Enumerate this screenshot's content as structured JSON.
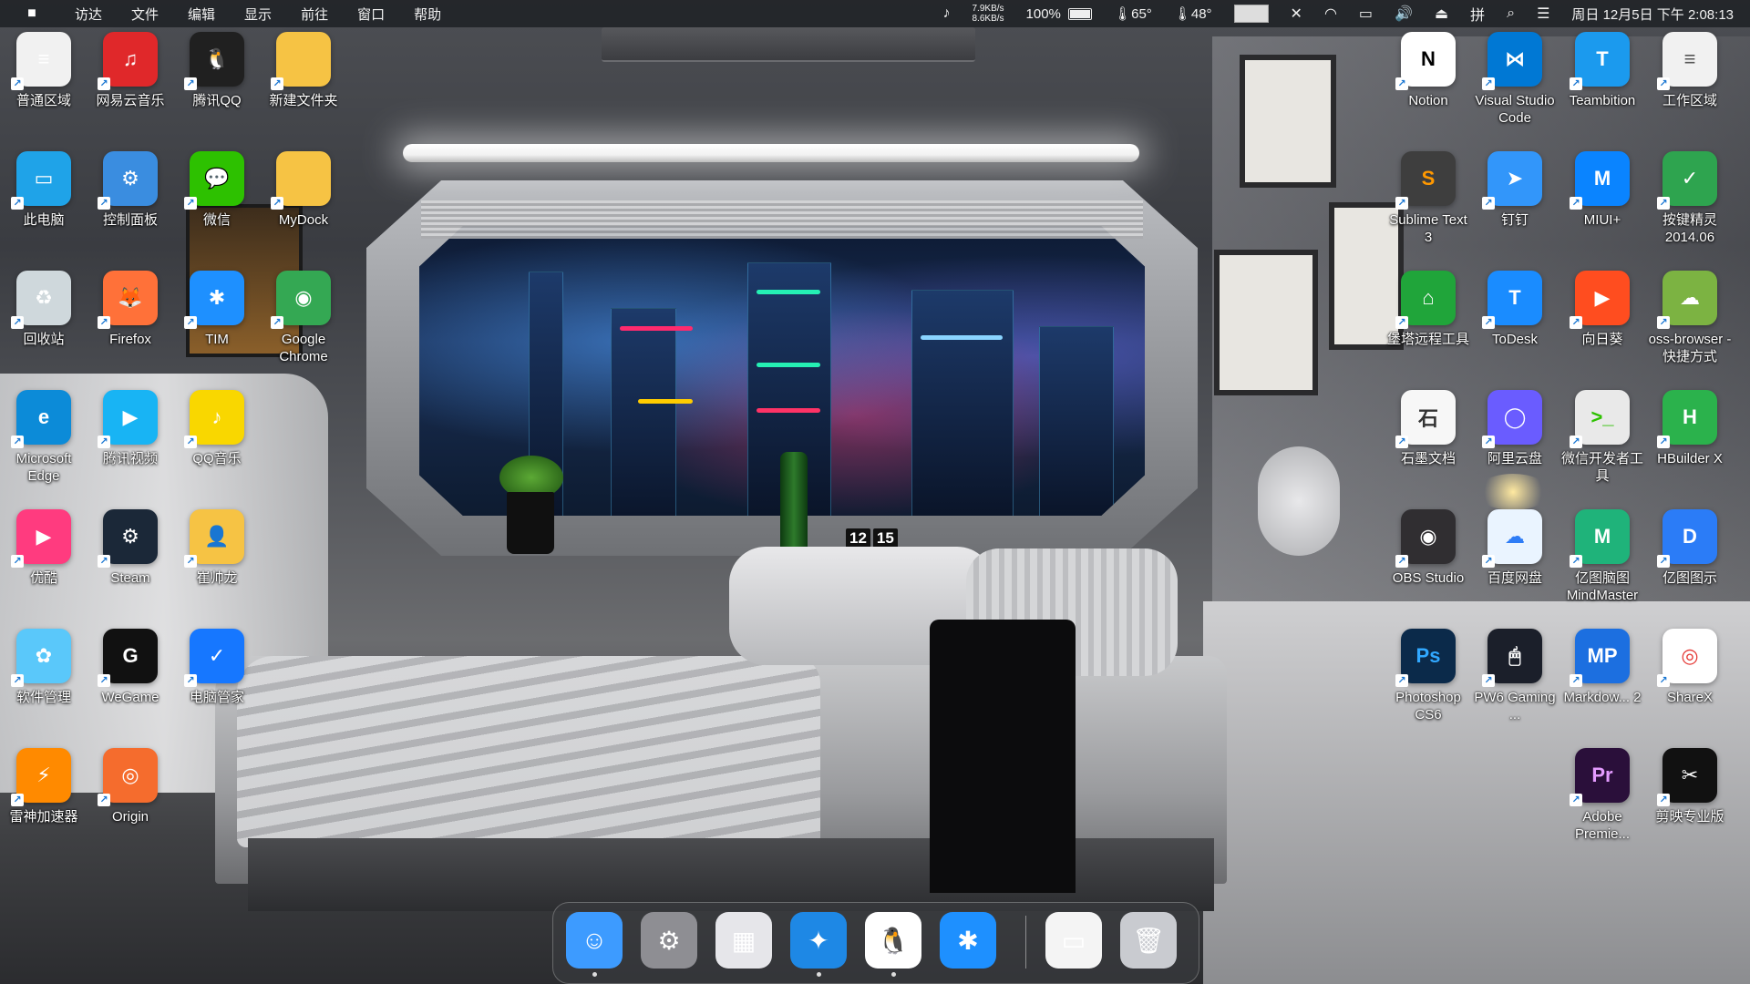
{
  "menubar": {
    "apple_icon": "apple-logo-icon",
    "menus": [
      "访达",
      "文件",
      "编辑",
      "显示",
      "前往",
      "窗口",
      "帮助"
    ],
    "net_up": "7.9KB/s",
    "net_down": "8.6KB/s",
    "battery": "100%",
    "temp1": "65°",
    "temp2": "48°",
    "datetime": "周日 12月5日 下午 2:08:13"
  },
  "left_icons": [
    {
      "label": "普通区域",
      "icon": "document-icon",
      "color": "#f1f1f1",
      "glyph": "≡"
    },
    {
      "label": "网易云音乐",
      "icon": "netease-music-icon",
      "color": "#e0282a",
      "glyph": "♫"
    },
    {
      "label": "腾讯QQ",
      "icon": "qq-penguin-icon",
      "color": "#202020",
      "glyph": "🐧"
    },
    {
      "label": "新建文件夹",
      "icon": "folder-icon",
      "color": "#f6c344",
      "glyph": ""
    },
    {
      "label": "此电脑",
      "icon": "computer-icon",
      "color": "#1fa3e8",
      "glyph": "▭"
    },
    {
      "label": "控制面板",
      "icon": "control-panel-icon",
      "color": "#3a8de0",
      "glyph": "⚙"
    },
    {
      "label": "微信",
      "icon": "wechat-icon",
      "color": "#2dc100",
      "glyph": "💬"
    },
    {
      "label": "MyDock",
      "icon": "folder-icon",
      "color": "#f6c344",
      "glyph": ""
    },
    {
      "label": "回收站",
      "icon": "recycle-bin-icon",
      "color": "#cfd8dc",
      "glyph": "♻"
    },
    {
      "label": "Firefox",
      "icon": "firefox-icon",
      "color": "#ff7139",
      "glyph": "🦊"
    },
    {
      "label": "TIM",
      "icon": "tim-icon",
      "color": "#1e90ff",
      "glyph": "✱"
    },
    {
      "label": "Google Chrome",
      "icon": "chrome-icon",
      "color": "#34a853",
      "glyph": "◉"
    },
    {
      "label": "Microsoft Edge",
      "icon": "edge-icon",
      "color": "#0c8bd8",
      "glyph": "e"
    },
    {
      "label": "腾讯视频",
      "icon": "tencent-video-icon",
      "color": "#18b4f4",
      "glyph": "▶"
    },
    {
      "label": "QQ音乐",
      "icon": "qq-music-icon",
      "color": "#f9d700",
      "glyph": "♪"
    },
    {
      "label": "优酷",
      "icon": "youku-icon",
      "color": "#ff3b7f",
      "glyph": "▶"
    },
    {
      "label": "Steam",
      "icon": "steam-icon",
      "color": "#1b2838",
      "glyph": "⚙"
    },
    {
      "label": "崔帅龙",
      "icon": "user-folder-icon",
      "color": "#f6c344",
      "glyph": "👤"
    },
    {
      "label": "软件管理",
      "icon": "software-manager-icon",
      "color": "#5ac8fa",
      "glyph": "✿"
    },
    {
      "label": "WeGame",
      "icon": "wegame-icon",
      "color": "#111111",
      "glyph": "G"
    },
    {
      "label": "电脑管家",
      "icon": "pc-manager-icon",
      "color": "#1677ff",
      "glyph": "✓"
    },
    {
      "label": "雷神加速器",
      "icon": "leishen-accelerator-icon",
      "color": "#ff8a00",
      "glyph": "⚡"
    },
    {
      "label": "Origin",
      "icon": "origin-icon",
      "color": "#f56c2d",
      "glyph": "◎"
    }
  ],
  "right_icons": [
    {
      "label": "Notion",
      "icon": "notion-icon",
      "color": "#ffffff",
      "glyph": "N",
      "fg": "#000"
    },
    {
      "label": "Visual Studio Code",
      "icon": "vscode-icon",
      "color": "#0078d4",
      "glyph": "⋈"
    },
    {
      "label": "Teambition",
      "icon": "teambition-icon",
      "color": "#1b9aee",
      "glyph": "T"
    },
    {
      "label": "工作区域",
      "icon": "document-icon",
      "color": "#f1f1f1",
      "glyph": "≡",
      "fg": "#555"
    },
    {
      "label": "Sublime Text 3",
      "icon": "sublime-text-icon",
      "color": "#3e3e3e",
      "glyph": "S",
      "fg": "#ff9800"
    },
    {
      "label": "钉钉",
      "icon": "dingtalk-icon",
      "color": "#3296fa",
      "glyph": "➤"
    },
    {
      "label": "MIUI+",
      "icon": "miui-plus-icon",
      "color": "#0a84ff",
      "glyph": "M"
    },
    {
      "label": "按键精灵2014.06",
      "icon": "keyboard-wizard-icon",
      "color": "#2ea44f",
      "glyph": "✓"
    },
    {
      "label": "堡塔远程工具",
      "icon": "bt-remote-tool-icon",
      "color": "#20a53a",
      "glyph": "⌂"
    },
    {
      "label": "ToDesk",
      "icon": "todesk-icon",
      "color": "#1a8cff",
      "glyph": "T"
    },
    {
      "label": "向日葵",
      "icon": "sunlogin-icon",
      "color": "#ff4d1f",
      "glyph": "▶"
    },
    {
      "label": "oss-browser - 快捷方式",
      "icon": "oss-browser-icon",
      "color": "#7cb342",
      "glyph": "☁"
    },
    {
      "label": "石墨文档",
      "icon": "shimo-docs-icon",
      "color": "#f7f7f7",
      "glyph": "石",
      "fg": "#333"
    },
    {
      "label": "阿里云盘",
      "icon": "aliyun-drive-icon",
      "color": "#6a5cff",
      "glyph": "◯"
    },
    {
      "label": "微信开发者工具",
      "icon": "wechat-devtools-icon",
      "color": "#e9e9e9",
      "glyph": ">_",
      "fg": "#2dc100"
    },
    {
      "label": "HBuilder X",
      "icon": "hbuilder-icon",
      "color": "#2bb24c",
      "glyph": "H"
    },
    {
      "label": "OBS Studio",
      "icon": "obs-icon",
      "color": "#302e31",
      "glyph": "◉"
    },
    {
      "label": "百度网盘",
      "icon": "baidu-netdisk-icon",
      "color": "#eaf4ff",
      "glyph": "☁",
      "fg": "#2e7cf6"
    },
    {
      "label": "亿图脑图MindMaster",
      "icon": "mindmaster-icon",
      "color": "#1fb37a",
      "glyph": "M"
    },
    {
      "label": "亿图图示",
      "icon": "edraw-icon",
      "color": "#2b7cf7",
      "glyph": "D"
    },
    {
      "label": "Photoshop CS6",
      "icon": "photoshop-icon",
      "color": "#0b2a4a",
      "glyph": "Ps",
      "fg": "#31a8ff"
    },
    {
      "label": "PW6 Gaming ...",
      "icon": "gaming-mouse-icon",
      "color": "#1b1f2a",
      "glyph": "🖱"
    },
    {
      "label": "Markdow... 2",
      "icon": "markdown-icon",
      "color": "#1c6fe0",
      "glyph": "MP"
    },
    {
      "label": "ShareX",
      "icon": "sharex-icon",
      "color": "#ffffff",
      "glyph": "◎",
      "fg": "#e53935"
    },
    {
      "label": "Adobe Premie...",
      "icon": "premiere-icon",
      "color": "#2a0f3a",
      "glyph": "Pr",
      "fg": "#e49bff"
    },
    {
      "label": "剪映专业版",
      "icon": "capcut-icon",
      "color": "#111111",
      "glyph": "✂"
    }
  ],
  "dock": [
    {
      "name": "finder-icon",
      "color": "#3d9bff",
      "glyph": "☺",
      "running": true
    },
    {
      "name": "system-preferences-icon",
      "color": "#8e8e93",
      "glyph": "⚙",
      "running": false
    },
    {
      "name": "launchpad-icon",
      "color": "#e6e6ea",
      "glyph": "▦",
      "running": false
    },
    {
      "name": "safari-icon",
      "color": "#1e88e5",
      "glyph": "✦",
      "running": true
    },
    {
      "name": "qq-penguin-icon",
      "color": "#ffffff",
      "glyph": "🐧",
      "running": true
    },
    {
      "name": "tim-icon",
      "color": "#1e90ff",
      "glyph": "✱",
      "running": false
    },
    {
      "name": "screenshot-document-icon",
      "color": "#f4f4f4",
      "glyph": "▭",
      "running": false
    },
    {
      "name": "trash-icon",
      "color": "#c9cbd0",
      "glyph": "🗑",
      "running": false
    }
  ],
  "wallpaper": {
    "clock_hours": "12",
    "clock_minutes": "15"
  }
}
